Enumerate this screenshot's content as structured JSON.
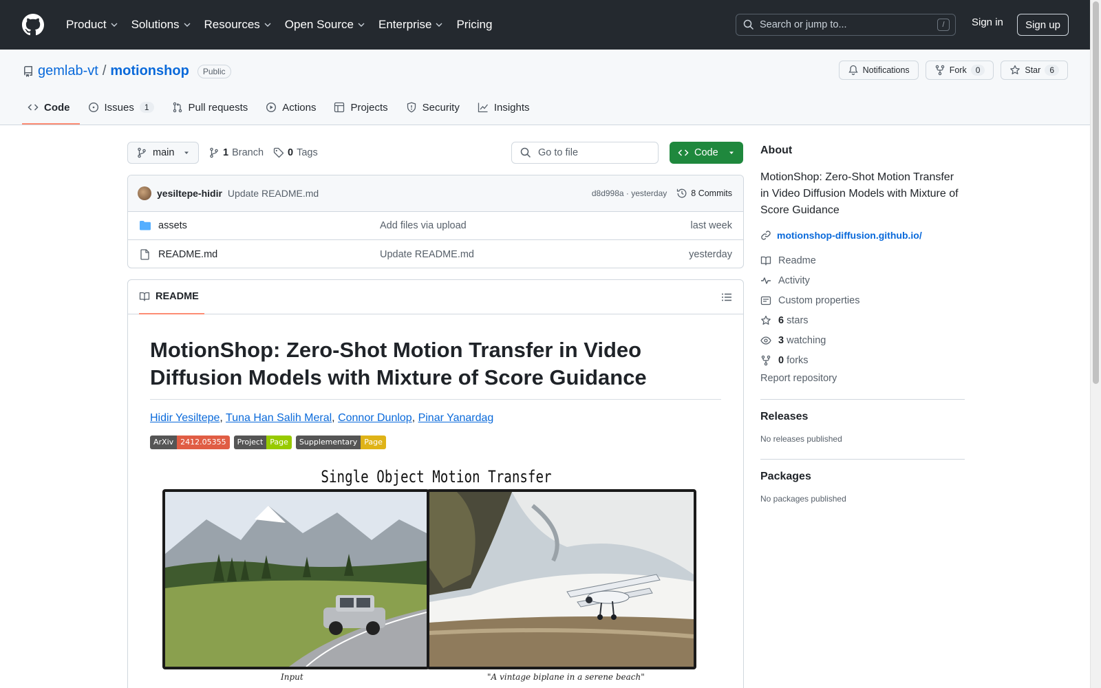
{
  "header": {
    "nav": [
      "Product",
      "Solutions",
      "Resources",
      "Open Source",
      "Enterprise",
      "Pricing"
    ],
    "search_placeholder": "Search or jump to...",
    "search_shortcut": "/",
    "signin": "Sign in",
    "signup": "Sign up"
  },
  "repo": {
    "owner": "gemlab-vt",
    "separator": "/",
    "name": "motionshop",
    "visibility": "Public",
    "notifications_label": "Notifications",
    "fork_label": "Fork",
    "fork_count": "0",
    "star_label": "Star",
    "star_count": "6"
  },
  "tabs": [
    {
      "label": "Code",
      "icon": "code-icon"
    },
    {
      "label": "Issues",
      "icon": "issue-icon",
      "count": "1"
    },
    {
      "label": "Pull requests",
      "icon": "pull-request-icon"
    },
    {
      "label": "Actions",
      "icon": "play-icon"
    },
    {
      "label": "Projects",
      "icon": "table-icon"
    },
    {
      "label": "Security",
      "icon": "shield-icon"
    },
    {
      "label": "Insights",
      "icon": "graph-icon"
    }
  ],
  "branch": {
    "current": "main",
    "branch_count": "1",
    "branch_label": "Branch",
    "tag_count": "0",
    "tag_label": "Tags",
    "goto_placeholder": "Go to file",
    "code_button": "Code"
  },
  "commit": {
    "author": "yesiltepe-hidir",
    "message": "Update README.md",
    "hash_time": "d8d998a · yesterday",
    "commits_label": "8 Commits"
  },
  "files": [
    {
      "type": "folder",
      "name": "assets",
      "message": "Add files via upload",
      "date": "last week"
    },
    {
      "type": "file",
      "name": "README.md",
      "message": "Update README.md",
      "date": "yesterday"
    }
  ],
  "readme": {
    "tab_label": "README",
    "title": "MotionShop: Zero-Shot Motion Transfer in Video Diffusion Models with Mixture of Score Guidance",
    "authors": [
      "Hidir Yesiltepe",
      "Tuna Han Salih Meral",
      "Connor Dunlop",
      "Pinar Yanardag"
    ],
    "author_sep": ", ",
    "badges": [
      {
        "left": "ArXiv",
        "right": "2412.05355",
        "color": "#e05d44"
      },
      {
        "left": "Project",
        "right": "Page",
        "color": "#97ca00"
      },
      {
        "left": "Supplementary",
        "right": "Page",
        "color": "#dfb317"
      }
    ],
    "figure": {
      "title": "Single Object Motion Transfer",
      "left_caption": "Input",
      "right_caption": "\"A vintage biplane in a serene beach\""
    }
  },
  "about": {
    "heading": "About",
    "description": "MotionShop: Zero-Shot Motion Transfer in Video Diffusion Models with Mixture of Score Guidance",
    "link": "motionshop-diffusion.github.io/",
    "items": [
      {
        "icon": "book-icon",
        "label": "Readme"
      },
      {
        "icon": "pulse-icon",
        "label": "Activity"
      },
      {
        "icon": "note-icon",
        "label": "Custom properties"
      },
      {
        "icon": "star-icon",
        "count": "6",
        "label": "stars"
      },
      {
        "icon": "eye-icon",
        "count": "3",
        "label": "watching"
      },
      {
        "icon": "fork-icon",
        "count": "0",
        "label": "forks"
      }
    ],
    "report": "Report repository"
  },
  "releases": {
    "heading": "Releases",
    "text": "No releases published"
  },
  "packages": {
    "heading": "Packages",
    "text": "No packages published"
  },
  "colors": {
    "header_bg": "#24292f",
    "accent_tab": "#fd8c73",
    "primary_green": "#1f883d",
    "link": "#0969da"
  }
}
